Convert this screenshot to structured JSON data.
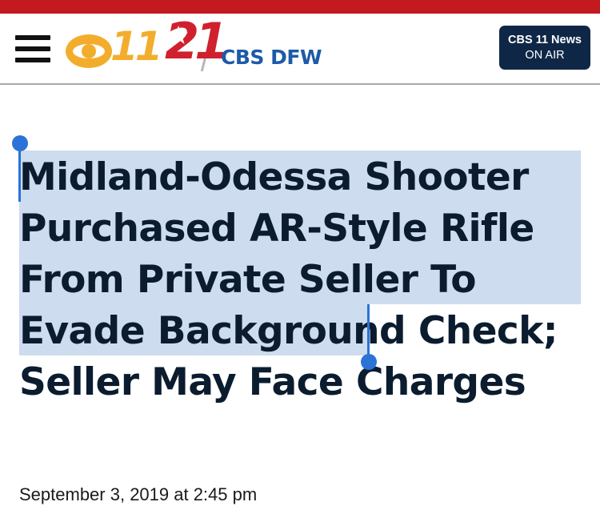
{
  "header": {
    "logo_text": "CBS 11 / 21 CBS DFW",
    "logo": {
      "eleven": "11",
      "twentyone": "21",
      "cbsdfw": "CBS DFW"
    },
    "live_button": {
      "line1": "CBS 11 News",
      "line2": "ON AIR"
    }
  },
  "article": {
    "headline": "Midland-Odessa Shooter Purchased AR-Style Rifle From Private Seller To Evade Background Check; Seller May Face Charges",
    "selected_text": "Midland-Odessa Shooter Purchased AR-Style Rifle From Private Seller To Evade Background Check",
    "dateline": "September 3, 2019 at 2:45 pm"
  },
  "icons": {
    "menu": "hamburger-menu-icon",
    "selection_start": "selection-start-handle-icon",
    "selection_end": "selection-end-handle-icon",
    "logo_eye": "cbs-eye-icon",
    "logo_star": "star-icon"
  },
  "colors": {
    "top_bar": "#c31a1f",
    "logo_gold": "#f3ad2c",
    "logo_red": "#d0202e",
    "logo_blue": "#1d5aa8",
    "live_button": "#0f2747",
    "selection_highlight": "#cddcee",
    "selection_handle": "#2b73d6"
  }
}
